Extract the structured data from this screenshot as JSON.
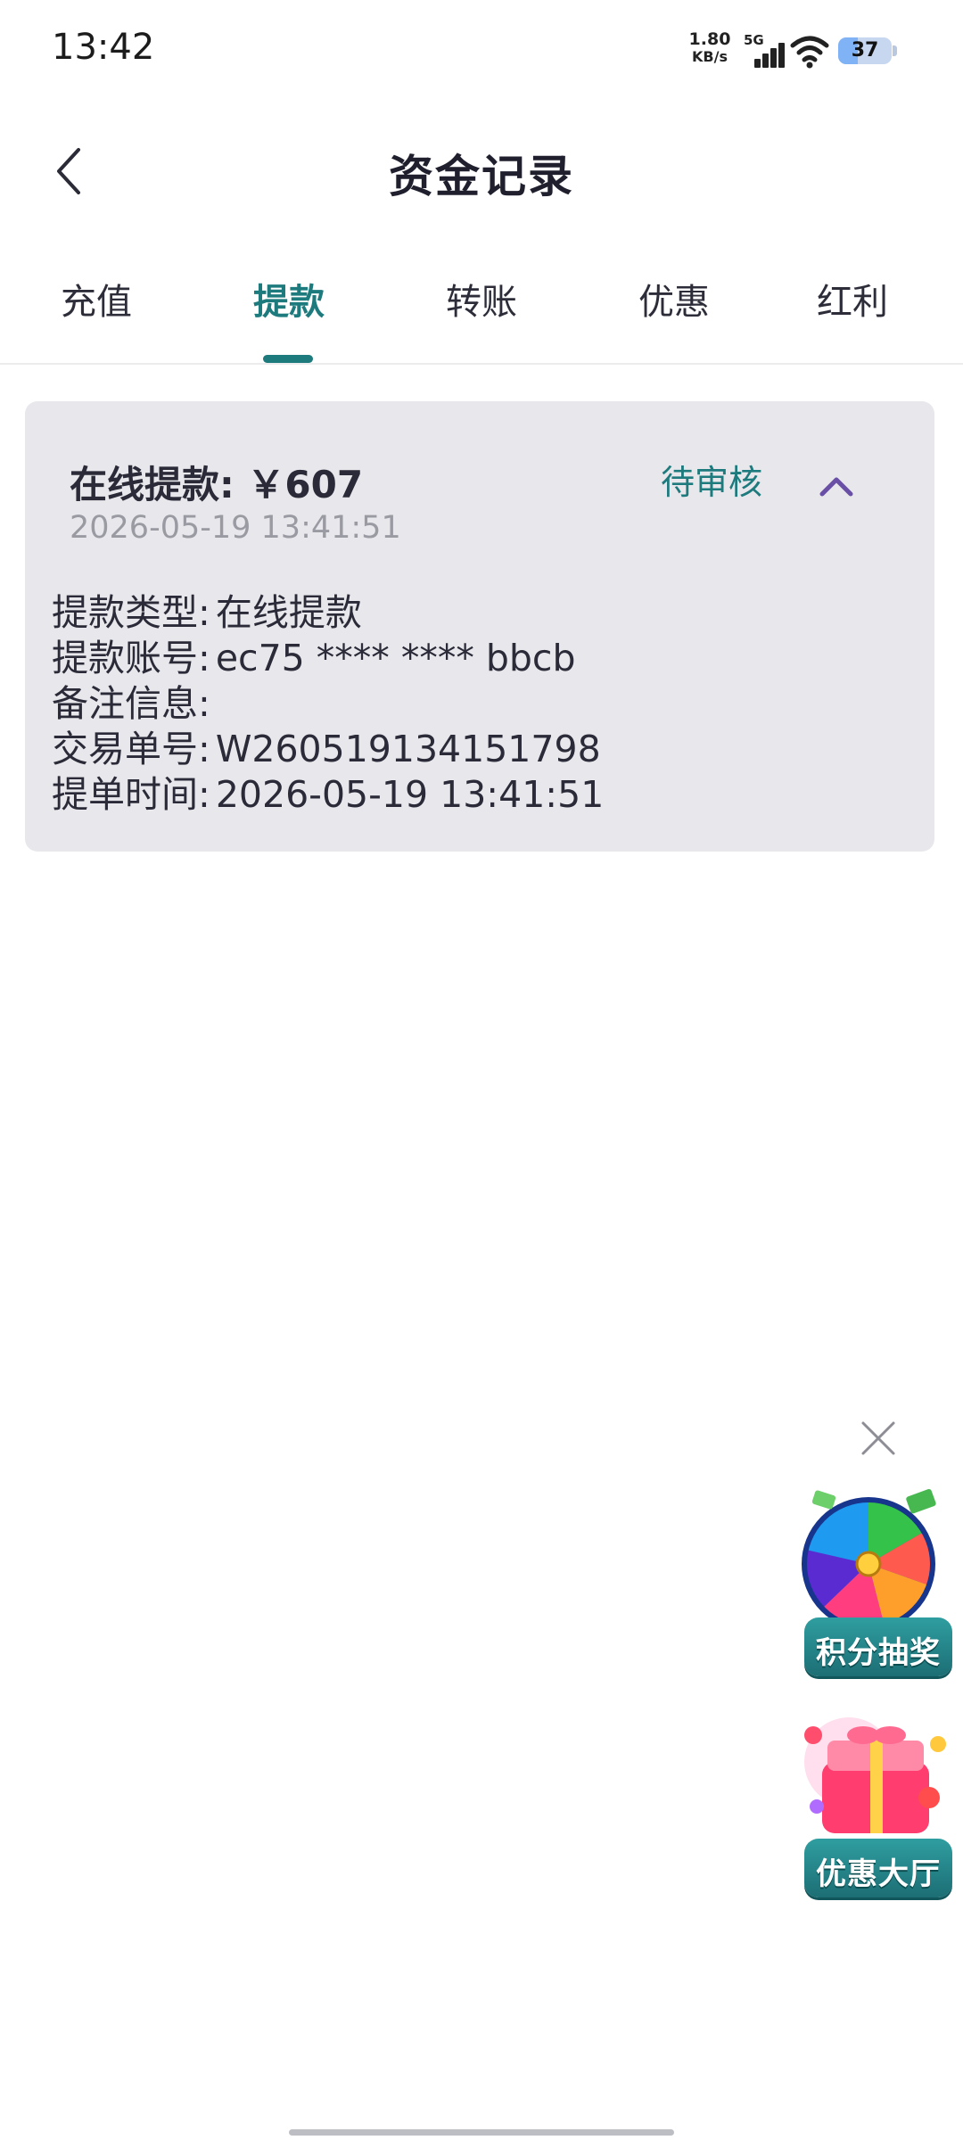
{
  "status_bar": {
    "time": "13:42",
    "net_speed_value": "1.80",
    "net_speed_unit": "KB/s",
    "network_type": "5G",
    "battery_level": "37",
    "battery_fraction": 0.37
  },
  "header": {
    "title": "资金记录",
    "back_icon": "chevron-left-icon"
  },
  "tabs": [
    {
      "label": "充值",
      "active": false
    },
    {
      "label": "提款",
      "active": true
    },
    {
      "label": "转账",
      "active": false
    },
    {
      "label": "优惠",
      "active": false
    },
    {
      "label": "红利",
      "active": false
    }
  ],
  "record": {
    "title": "在线提款: ￥607",
    "time": "2026-05-19 13:41:51",
    "status": "待审核",
    "status_color": "#1d7a7d",
    "toggle_icon": "chevron-up-icon",
    "details": [
      {
        "label": "提款类型:",
        "value": "在线提款"
      },
      {
        "label": "提款账号:",
        "value": "ec75 **** **** bbcb"
      },
      {
        "label": "备注信息:",
        "value": ""
      },
      {
        "label": "交易单号:",
        "value": "W260519134151798"
      },
      {
        "label": "提单时间:",
        "value": "2026-05-19 13:41:51"
      }
    ]
  },
  "floating": {
    "close_icon": "close-icon",
    "lottery_label": "积分抽奖",
    "promo_hall_label": "优惠大厅"
  },
  "colors": {
    "accent": "#1d7a7d",
    "card_bg": "#e8e8ec",
    "chevron": "#6a4fa6"
  }
}
